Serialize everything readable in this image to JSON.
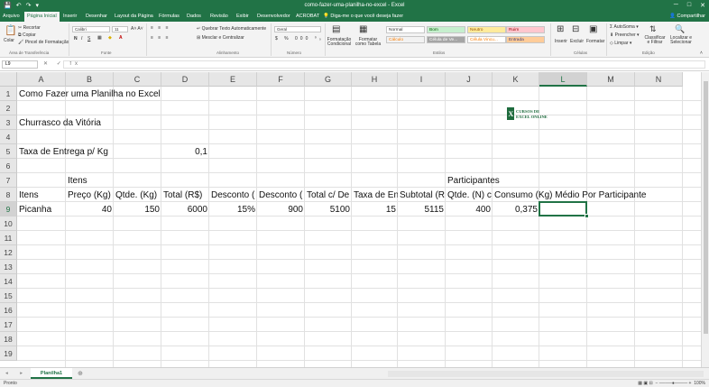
{
  "titlebar": {
    "title": "como-fazer-uma-planilha-no-excel - Excel",
    "qat_save": "💾",
    "qat_undo": "↶",
    "qat_redo": "↷",
    "qat_more": "▾",
    "min": "─",
    "restore": "□",
    "close": "✕"
  },
  "tabs": [
    {
      "label": "Arquivo"
    },
    {
      "label": "Página Inicial"
    },
    {
      "label": "Inserir"
    },
    {
      "label": "Desenhar"
    },
    {
      "label": "Layout da Página"
    },
    {
      "label": "Fórmulas"
    },
    {
      "label": "Dados"
    },
    {
      "label": "Revisão"
    },
    {
      "label": "Exibir"
    },
    {
      "label": "Desenvolvedor"
    },
    {
      "label": "ACROBAT"
    }
  ],
  "tellme": "Diga-me o que você deseja fazer",
  "share": "Compartilhar",
  "ribbon": {
    "paste": "Colar",
    "cut": "Recortar",
    "copy": "Copiar",
    "format_painter": "Pincel de Formatação",
    "clipboard": "Área de Transferência",
    "font_name": "Calibri",
    "font_size": "11",
    "font_group": "Fonte",
    "bold": "N",
    "italic": "I",
    "underline": "S",
    "wrap_text": "Quebrar Texto Automaticamente",
    "merge_center": "Mesclar e Centralizar",
    "alignment": "Alinhamento",
    "number_format": "Geral",
    "number": "Número",
    "cond_format": "Formatação Condicional",
    "format_table": "Formatar como Tabela",
    "styles": [
      "Normal",
      "Bom",
      "Neutro",
      "Ruim",
      "Cálculo",
      "Célula de Ve...",
      "Célula Vincu...",
      "Entrada"
    ],
    "styles_group": "Estilos",
    "insert": "Inserir",
    "delete": "Excluir",
    "format": "Formatar",
    "cells": "Células",
    "autosum": "AutoSoma",
    "fill": "Preencher",
    "clear": "Limpar",
    "sort_filter": "Classificar e Filtrar",
    "find_select": "Localizar e Selecionar",
    "editing": "Edição"
  },
  "formula": {
    "name_box": "L9",
    "fx": "✕ ✓ fx",
    "value": ""
  },
  "columns": [
    "A",
    "B",
    "C",
    "D",
    "E",
    "F",
    "G",
    "H",
    "I",
    "J",
    "K",
    "L",
    "M",
    "N"
  ],
  "rows": [
    "1",
    "2",
    "3",
    "4",
    "5",
    "6",
    "7",
    "8",
    "9",
    "10",
    "11",
    "12",
    "13",
    "14",
    "15",
    "16",
    "17",
    "18",
    "19"
  ],
  "cells": {
    "A1": "Como Fazer uma Planilha no Excel",
    "A3": "Churrasco da Vitória",
    "A5": "Taxa de Entrega p/ Kg",
    "D5": "0,1",
    "B7": "Itens",
    "J7": "Participantes",
    "A8": "Itens",
    "B8": "Preço (Kg)",
    "C8": "Qtde. (Kg)",
    "D8": "Total (R$)",
    "E8": "Desconto (",
    "F8": "Desconto (",
    "G8": "Total c/ De",
    "H8": "Taxa de En",
    "I8": "Subtotal (R",
    "J8": "Qtde. (N) c",
    "K8": "Consumo (Kg) Médio Por Participante",
    "A9": "Picanha",
    "B9": "40",
    "C9": "150",
    "D9": "6000",
    "E9": "15%",
    "F9": "900",
    "G9": "5100",
    "H9": "15",
    "I9": "5115",
    "J9": "400",
    "K9": "0,375"
  },
  "logo": {
    "line1": "CURSOS DE",
    "line2": "EXCEL ONLINE",
    "mark": "X"
  },
  "sheet": {
    "tab": "Planilha1",
    "add": "⊕",
    "nav": "◂ ▸"
  },
  "status": {
    "mode": "Pronto",
    "zoom": "100%"
  },
  "colors": {
    "accent": "#217346",
    "grid": "#e1e1e1"
  }
}
